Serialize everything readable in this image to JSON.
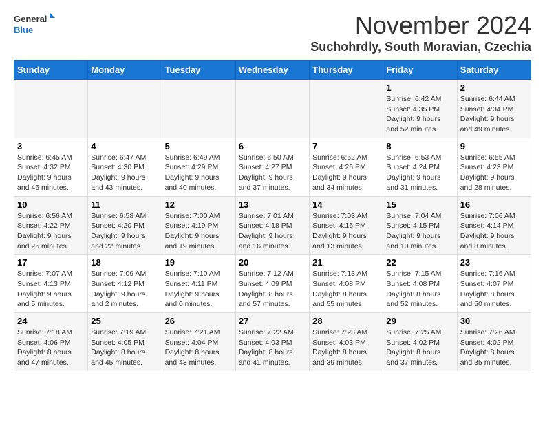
{
  "logo": {
    "line1": "General",
    "line2": "Blue"
  },
  "title": "November 2024",
  "location": "Suchohrdly, South Moravian, Czechia",
  "days_header": [
    "Sunday",
    "Monday",
    "Tuesday",
    "Wednesday",
    "Thursday",
    "Friday",
    "Saturday"
  ],
  "weeks": [
    [
      {
        "day": "",
        "info": ""
      },
      {
        "day": "",
        "info": ""
      },
      {
        "day": "",
        "info": ""
      },
      {
        "day": "",
        "info": ""
      },
      {
        "day": "",
        "info": ""
      },
      {
        "day": "1",
        "info": "Sunrise: 6:42 AM\nSunset: 4:35 PM\nDaylight: 9 hours and 52 minutes."
      },
      {
        "day": "2",
        "info": "Sunrise: 6:44 AM\nSunset: 4:34 PM\nDaylight: 9 hours and 49 minutes."
      }
    ],
    [
      {
        "day": "3",
        "info": "Sunrise: 6:45 AM\nSunset: 4:32 PM\nDaylight: 9 hours and 46 minutes."
      },
      {
        "day": "4",
        "info": "Sunrise: 6:47 AM\nSunset: 4:30 PM\nDaylight: 9 hours and 43 minutes."
      },
      {
        "day": "5",
        "info": "Sunrise: 6:49 AM\nSunset: 4:29 PM\nDaylight: 9 hours and 40 minutes."
      },
      {
        "day": "6",
        "info": "Sunrise: 6:50 AM\nSunset: 4:27 PM\nDaylight: 9 hours and 37 minutes."
      },
      {
        "day": "7",
        "info": "Sunrise: 6:52 AM\nSunset: 4:26 PM\nDaylight: 9 hours and 34 minutes."
      },
      {
        "day": "8",
        "info": "Sunrise: 6:53 AM\nSunset: 4:24 PM\nDaylight: 9 hours and 31 minutes."
      },
      {
        "day": "9",
        "info": "Sunrise: 6:55 AM\nSunset: 4:23 PM\nDaylight: 9 hours and 28 minutes."
      }
    ],
    [
      {
        "day": "10",
        "info": "Sunrise: 6:56 AM\nSunset: 4:22 PM\nDaylight: 9 hours and 25 minutes."
      },
      {
        "day": "11",
        "info": "Sunrise: 6:58 AM\nSunset: 4:20 PM\nDaylight: 9 hours and 22 minutes."
      },
      {
        "day": "12",
        "info": "Sunrise: 7:00 AM\nSunset: 4:19 PM\nDaylight: 9 hours and 19 minutes."
      },
      {
        "day": "13",
        "info": "Sunrise: 7:01 AM\nSunset: 4:18 PM\nDaylight: 9 hours and 16 minutes."
      },
      {
        "day": "14",
        "info": "Sunrise: 7:03 AM\nSunset: 4:16 PM\nDaylight: 9 hours and 13 minutes."
      },
      {
        "day": "15",
        "info": "Sunrise: 7:04 AM\nSunset: 4:15 PM\nDaylight: 9 hours and 10 minutes."
      },
      {
        "day": "16",
        "info": "Sunrise: 7:06 AM\nSunset: 4:14 PM\nDaylight: 9 hours and 8 minutes."
      }
    ],
    [
      {
        "day": "17",
        "info": "Sunrise: 7:07 AM\nSunset: 4:13 PM\nDaylight: 9 hours and 5 minutes."
      },
      {
        "day": "18",
        "info": "Sunrise: 7:09 AM\nSunset: 4:12 PM\nDaylight: 9 hours and 2 minutes."
      },
      {
        "day": "19",
        "info": "Sunrise: 7:10 AM\nSunset: 4:11 PM\nDaylight: 9 hours and 0 minutes."
      },
      {
        "day": "20",
        "info": "Sunrise: 7:12 AM\nSunset: 4:09 PM\nDaylight: 8 hours and 57 minutes."
      },
      {
        "day": "21",
        "info": "Sunrise: 7:13 AM\nSunset: 4:08 PM\nDaylight: 8 hours and 55 minutes."
      },
      {
        "day": "22",
        "info": "Sunrise: 7:15 AM\nSunset: 4:08 PM\nDaylight: 8 hours and 52 minutes."
      },
      {
        "day": "23",
        "info": "Sunrise: 7:16 AM\nSunset: 4:07 PM\nDaylight: 8 hours and 50 minutes."
      }
    ],
    [
      {
        "day": "24",
        "info": "Sunrise: 7:18 AM\nSunset: 4:06 PM\nDaylight: 8 hours and 47 minutes."
      },
      {
        "day": "25",
        "info": "Sunrise: 7:19 AM\nSunset: 4:05 PM\nDaylight: 8 hours and 45 minutes."
      },
      {
        "day": "26",
        "info": "Sunrise: 7:21 AM\nSunset: 4:04 PM\nDaylight: 8 hours and 43 minutes."
      },
      {
        "day": "27",
        "info": "Sunrise: 7:22 AM\nSunset: 4:03 PM\nDaylight: 8 hours and 41 minutes."
      },
      {
        "day": "28",
        "info": "Sunrise: 7:23 AM\nSunset: 4:03 PM\nDaylight: 8 hours and 39 minutes."
      },
      {
        "day": "29",
        "info": "Sunrise: 7:25 AM\nSunset: 4:02 PM\nDaylight: 8 hours and 37 minutes."
      },
      {
        "day": "30",
        "info": "Sunrise: 7:26 AM\nSunset: 4:02 PM\nDaylight: 8 hours and 35 minutes."
      }
    ]
  ]
}
